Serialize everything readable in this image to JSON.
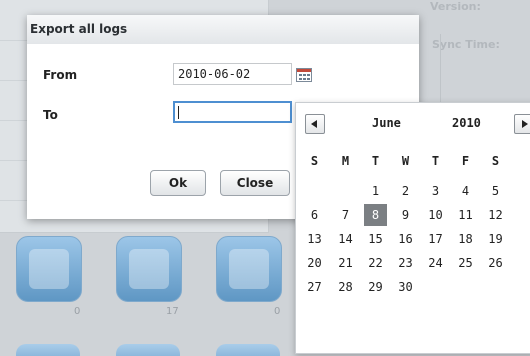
{
  "background": {
    "labels": {
      "version": "Version:",
      "sync_time": "Sync Time:"
    },
    "tile_counts": [
      "0",
      "17",
      "0"
    ]
  },
  "dialog": {
    "title": "Export all logs",
    "from_label": "From",
    "from_value": "2010-06-02",
    "to_label": "To",
    "to_value": "",
    "ok_label": "Ok",
    "close_label": "Close"
  },
  "datepicker": {
    "month": "June",
    "year": "2010",
    "weekdays": [
      "S",
      "M",
      "T",
      "W",
      "T",
      "F",
      "S"
    ],
    "selected_day": "8",
    "weeks": [
      [
        "",
        "",
        "1",
        "2",
        "3",
        "4",
        "5"
      ],
      [
        "6",
        "7",
        "8",
        "9",
        "10",
        "11",
        "12"
      ],
      [
        "13",
        "14",
        "15",
        "16",
        "17",
        "18",
        "19"
      ],
      [
        "20",
        "21",
        "22",
        "23",
        "24",
        "25",
        "26"
      ],
      [
        "27",
        "28",
        "29",
        "30",
        "",
        "",
        ""
      ]
    ]
  },
  "colors": {
    "focus_border": "#4e8fd1",
    "selected_day_bg": "#7b7f83",
    "tile_blue": "#5f97c4"
  },
  "icons": {
    "calendar": "calendar-icon",
    "prev": "chevron-left-icon",
    "next": "chevron-right-icon"
  }
}
